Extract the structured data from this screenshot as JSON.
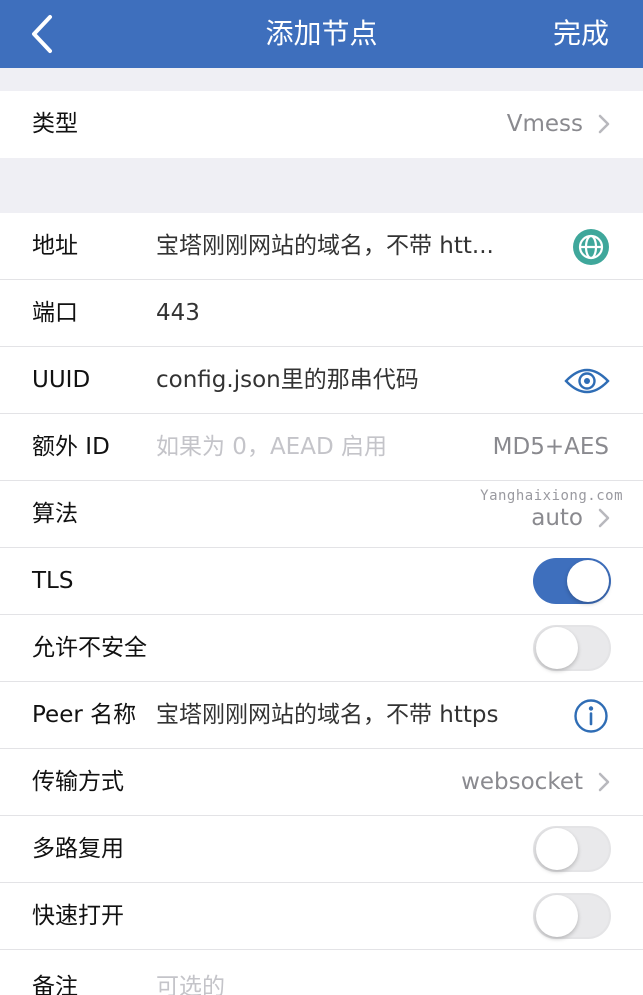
{
  "header": {
    "title": "添加节点",
    "done_label": "完成"
  },
  "type_row": {
    "label": "类型",
    "value": "Vmess"
  },
  "address": {
    "label": "地址",
    "value": "宝塔刚刚网站的域名，不带 htt..."
  },
  "port": {
    "label": "端口",
    "value": "443"
  },
  "uuid": {
    "label": "UUID",
    "value": "config.json里的那串代码"
  },
  "extra_id": {
    "label": "额外 ID",
    "placeholder": "如果为 0，AEAD 启用",
    "right": "MD5+AES"
  },
  "algorithm": {
    "label": "算法",
    "value": "auto"
  },
  "tls": {
    "label": "TLS",
    "enabled": true
  },
  "allow_insecure": {
    "label": "允许不安全",
    "enabled": false
  },
  "peer_name": {
    "label": "Peer 名称",
    "value": "宝塔刚刚网站的域名，不带 https"
  },
  "transport": {
    "label": "传输方式",
    "value": "websocket"
  },
  "multiplex": {
    "label": "多路复用",
    "enabled": false
  },
  "fast_open": {
    "label": "快速打开",
    "enabled": false
  },
  "remark": {
    "label": "备注",
    "placeholder": "可选的"
  },
  "watermark": "Yanghaixiong.com",
  "colors": {
    "accent": "#3e6fbd",
    "icon_teal": "#3fa79b",
    "icon_blue": "#2f6db5"
  }
}
